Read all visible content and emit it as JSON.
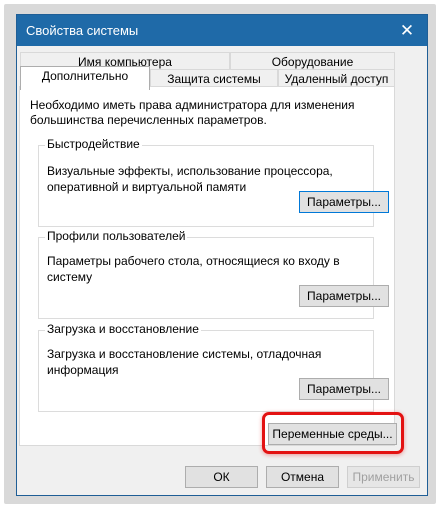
{
  "window": {
    "title": "Свойства системы"
  },
  "tabs": {
    "row1": [
      "Имя компьютера",
      "Оборудование"
    ],
    "row2": [
      "Дополнительно",
      "Защита системы",
      "Удаленный доступ"
    ]
  },
  "advanced": {
    "intro": "Необходимо иметь права администратора для изменения большинства перечисленных параметров.",
    "performance": {
      "label": "Быстродействие",
      "text": "Визуальные эффекты, использование процессора, оперативной и виртуальной памяти",
      "button": "Параметры..."
    },
    "profiles": {
      "label": "Профили пользователей",
      "text": "Параметры рабочего стола, относящиеся ко входу в систему",
      "button": "Параметры..."
    },
    "startup": {
      "label": "Загрузка и восстановление",
      "text": "Загрузка и восстановление системы, отладочная информация",
      "button": "Параметры..."
    },
    "env_button": "Переменные среды..."
  },
  "footer": {
    "ok": "ОК",
    "cancel": "Отмена",
    "apply": "Применить"
  },
  "colors": {
    "titlebar": "#1f6aa8",
    "highlight": "#e31212"
  }
}
